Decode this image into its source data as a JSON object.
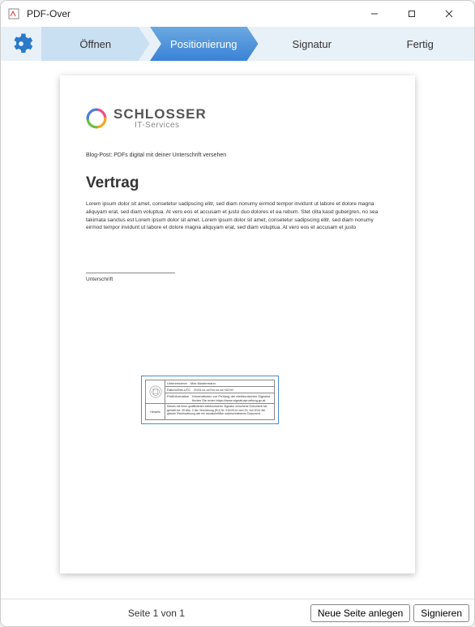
{
  "window": {
    "title": "PDF-Over"
  },
  "steps": {
    "open": "Öffnen",
    "positioning": "Positionierung",
    "signature": "Signatur",
    "finish": "Fertig"
  },
  "document": {
    "logo_name": "SCHLOSSER",
    "logo_sub": "IT-Services",
    "blogpost": "Blog-Post: PDFs digital mit deiner Unterschrift versehen",
    "heading": "Vertrag",
    "lorem": "Lorem ipsum dolor sit amet, consetetur sadipscing elitr, sed diam nonumy eirmod tempor invidunt ut labore et dolore magna aliquyam erat, sed diam voluptua. At vero eos et accusam et justo duo dolores et ea rebum. Stet clita kasd gubergren, no sea takimata sanctus est Lorem ipsum dolor sit amet. Lorem ipsum dolor sit amet, consetetur sadipscing elitr, sed diam nonumy eirmod tempor invidunt ut labore et dolore magna aliquyam erat, sed diam voluptua. At vero eos et accusam et justo",
    "signature_label": "Unterschrift"
  },
  "sigblock": {
    "signed_by_label": "Unterzeichner",
    "signed_by": "Max Mustermann",
    "date_label": "Datum/Zeit-UTC",
    "date": "2023-xx-xxTxx:xx:xx+02:00",
    "check_label": "Prüfinformation",
    "check": "Informationen zur Prüfung der elektronischen Signatur finden Sie unter https://www.signaturpruefung.gv.at",
    "note_label": "Hinweis",
    "note": "Dieses mit einer qualifizierten elektronischen Signatur versehene Dokument hat gemäß Art. 25 Abs. 2 der Verordnung (EU) Nr. 910/2014 vom 23. Juli 2014 die gleiche Rechtswirkung wie ein handschriftlich unterschriebenes Dokument."
  },
  "footer": {
    "page_indicator": "Seite 1 von 1",
    "new_page": "Neue Seite anlegen",
    "sign": "Signieren"
  },
  "colors": {
    "accent": "#3b82d6",
    "accent_dark": "#1f62b8"
  }
}
